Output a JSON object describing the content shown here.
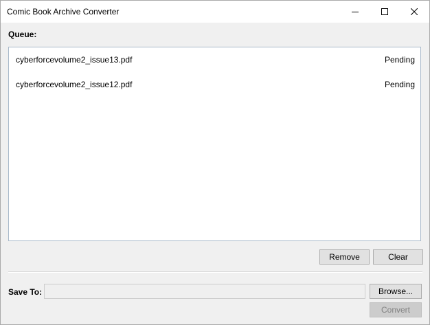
{
  "window": {
    "title": "Comic Book Archive Converter",
    "controls": {
      "minimize_icon": "minimize-icon",
      "maximize_icon": "maximize-icon",
      "close_icon": "close-icon"
    }
  },
  "queue": {
    "label": "Queue:",
    "items": [
      {
        "filename": "cyberforcevolume2_issue13.pdf",
        "status": "Pending"
      },
      {
        "filename": "cyberforcevolume2_issue12.pdf",
        "status": "Pending"
      }
    ]
  },
  "actions": {
    "remove_label": "Remove",
    "clear_label": "Clear"
  },
  "output": {
    "save_to_label": "Save To:",
    "save_to_value": "",
    "browse_label": "Browse...",
    "convert_label": "Convert",
    "convert_enabled": false
  },
  "colors": {
    "window_bg": "#f0f0f0",
    "titlebar_bg": "#ffffff",
    "list_border": "#a7b8c9",
    "button_bg": "#e1e1e1",
    "button_border": "#adadad",
    "disabled_text": "#838383"
  }
}
